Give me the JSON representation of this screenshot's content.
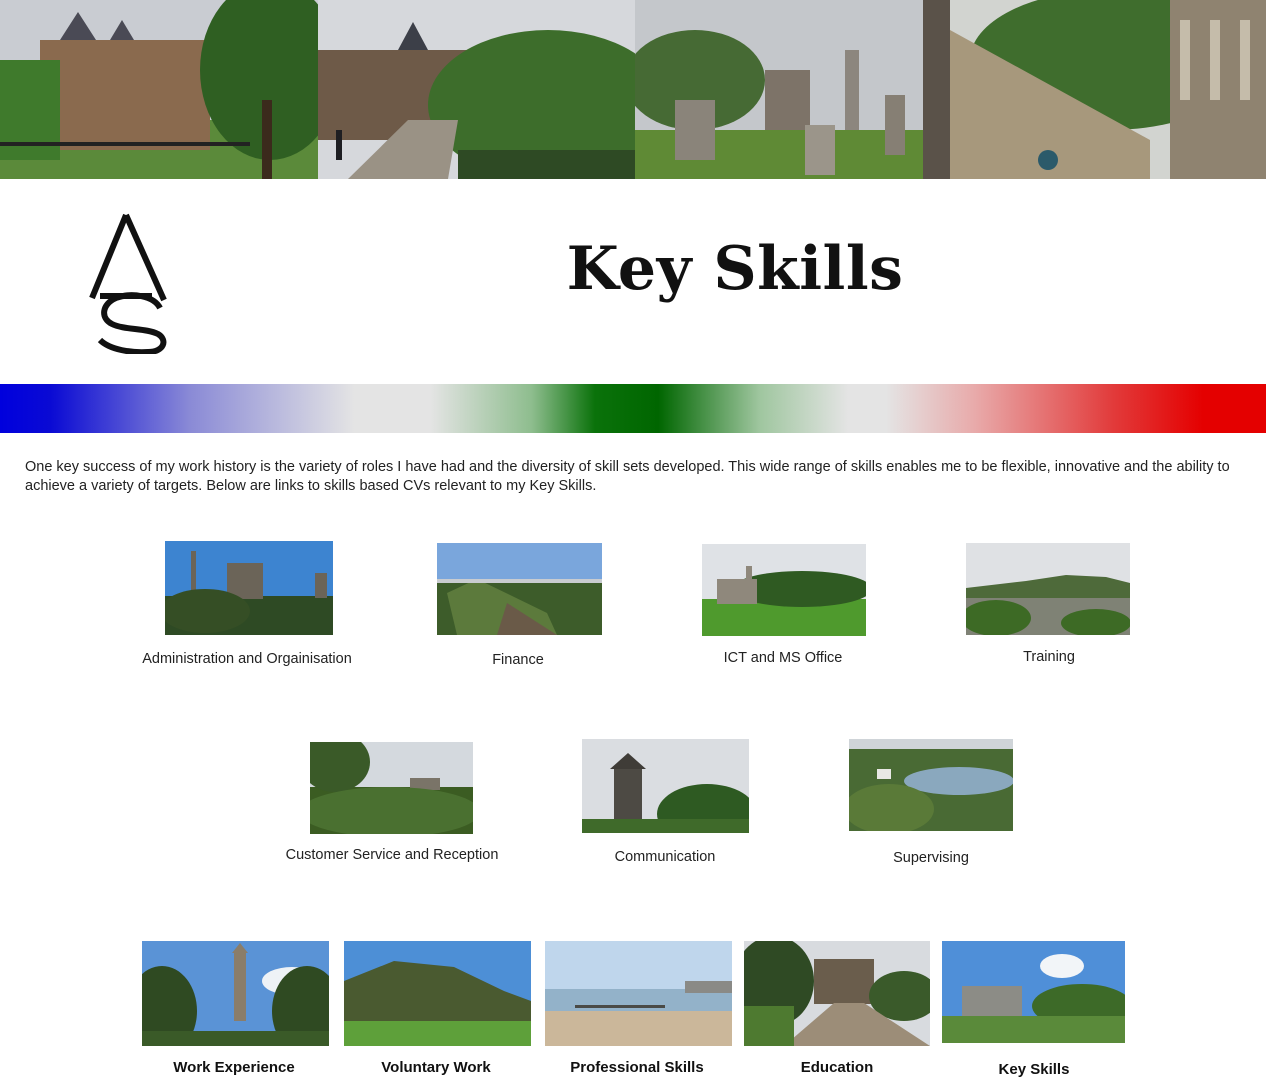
{
  "header": {
    "title": "Key Skills",
    "logo_text": "AS",
    "banner_photos": [
      "victorian-building-photo",
      "old-town-street-photo",
      "graveyard-photo",
      "stone-stairway-photo"
    ]
  },
  "intro": {
    "text": "One key success of my work history is the variety of roles I have had and the diversity of skill sets developed. This wide range of skills enables me to be flexible, innovative and the ability to achieve a variety of targets. Below are links to skills based CVs relevant to my Key Skills."
  },
  "skills": [
    {
      "label": "Administration and Orgainisation"
    },
    {
      "label": "Finance"
    },
    {
      "label": "ICT and MS Office"
    },
    {
      "label": "Training"
    },
    {
      "label": "Customer Service and Reception"
    },
    {
      "label": "Communication"
    },
    {
      "label": "Supervising"
    }
  ],
  "nav": [
    {
      "label": "Work Experience"
    },
    {
      "label": "Voluntary Work"
    },
    {
      "label": "Professional Skills"
    },
    {
      "label": "Education"
    },
    {
      "label": "Key Skills"
    }
  ],
  "colors": {
    "bar_blue": "#0000dd",
    "bar_green": "#006600",
    "bar_red": "#e40000",
    "background": "#ffffff"
  }
}
